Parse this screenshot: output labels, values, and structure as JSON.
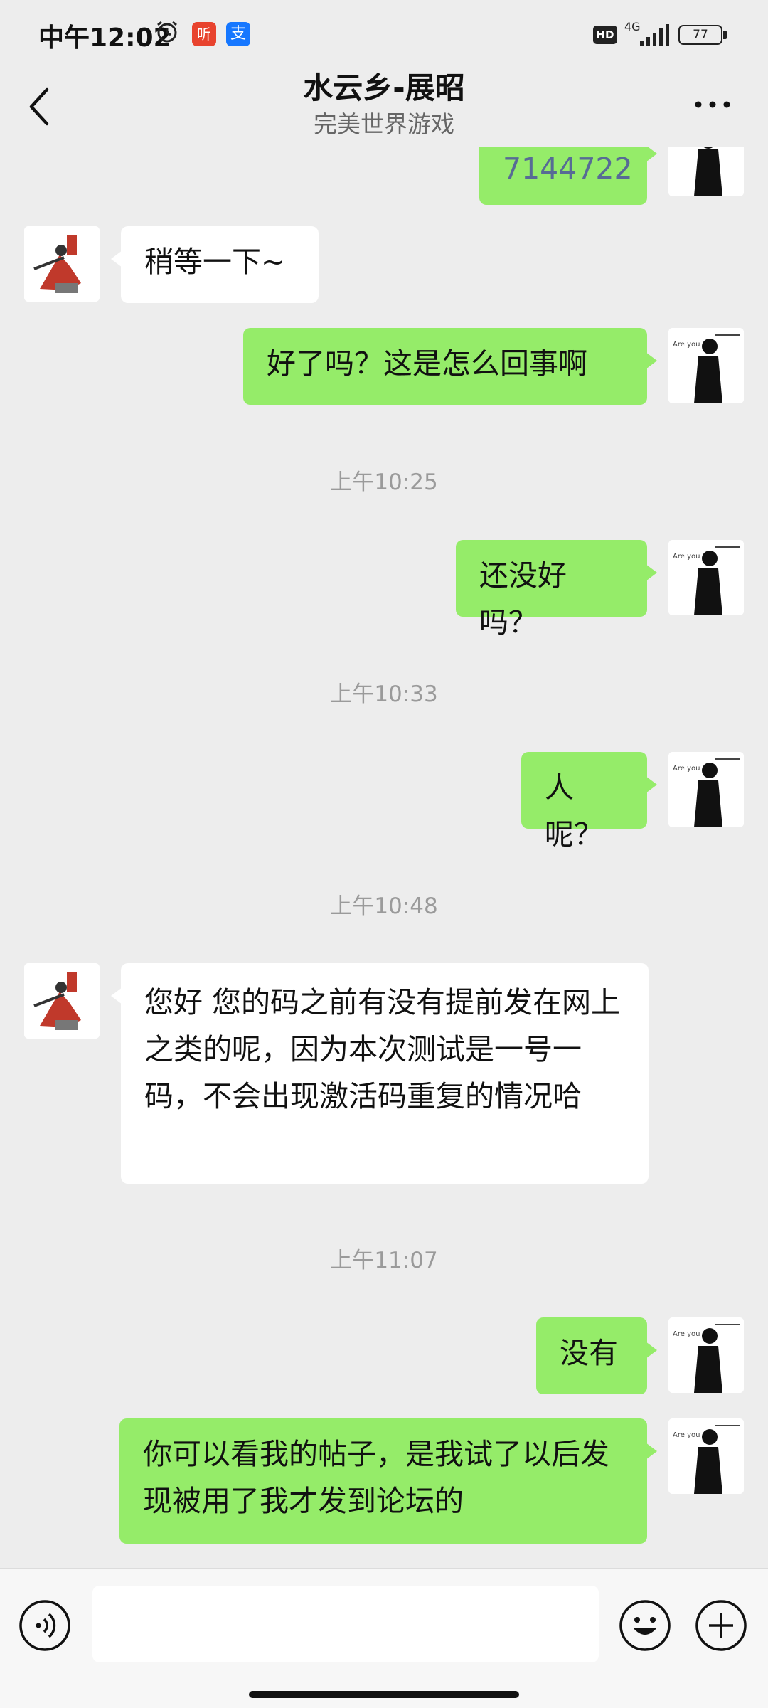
{
  "status_bar": {
    "time": "中午12:02",
    "app_badge_1": "听",
    "app_badge_2": "支",
    "hd": "HD",
    "network": "4G",
    "battery": "77"
  },
  "header": {
    "title": "水云乡-展昭",
    "subtitle": "完美世界游戏"
  },
  "messages": {
    "m0": {
      "text": "7144722",
      "sender": "me"
    },
    "m1": {
      "text": "稍等一下~",
      "sender": "them"
    },
    "m2": {
      "text": "好了吗？这是怎么回事啊",
      "sender": "me"
    },
    "t1": "上午10:25",
    "m3": {
      "text": "还没好吗？",
      "sender": "me"
    },
    "t2": "上午10:33",
    "m4": {
      "text": "人呢？",
      "sender": "me"
    },
    "t3": "上午10:48",
    "m5": {
      "text": "您好 您的码之前有没有提前发在网上之类的呢，因为本次测试是一号一码，不会出现激活码重复的情况哈",
      "sender": "them"
    },
    "t4": "上午11:07",
    "m6": {
      "text": "没有",
      "sender": "me"
    },
    "m7": {
      "text": "你可以看我的帖子，是我试了以后发现被用了我才发到论坛的",
      "sender": "me"
    }
  },
  "input": {
    "value": "",
    "placeholder": ""
  },
  "icons": {
    "back": "back-arrow-icon",
    "more": "more-dots-icon",
    "voice": "voice-icon",
    "emoji": "emoji-icon",
    "plus": "plus-icon"
  },
  "colors": {
    "my_bubble": "#95ec69",
    "their_bubble": "#ffffff",
    "background": "#ededed",
    "code_text": "#576b95"
  }
}
